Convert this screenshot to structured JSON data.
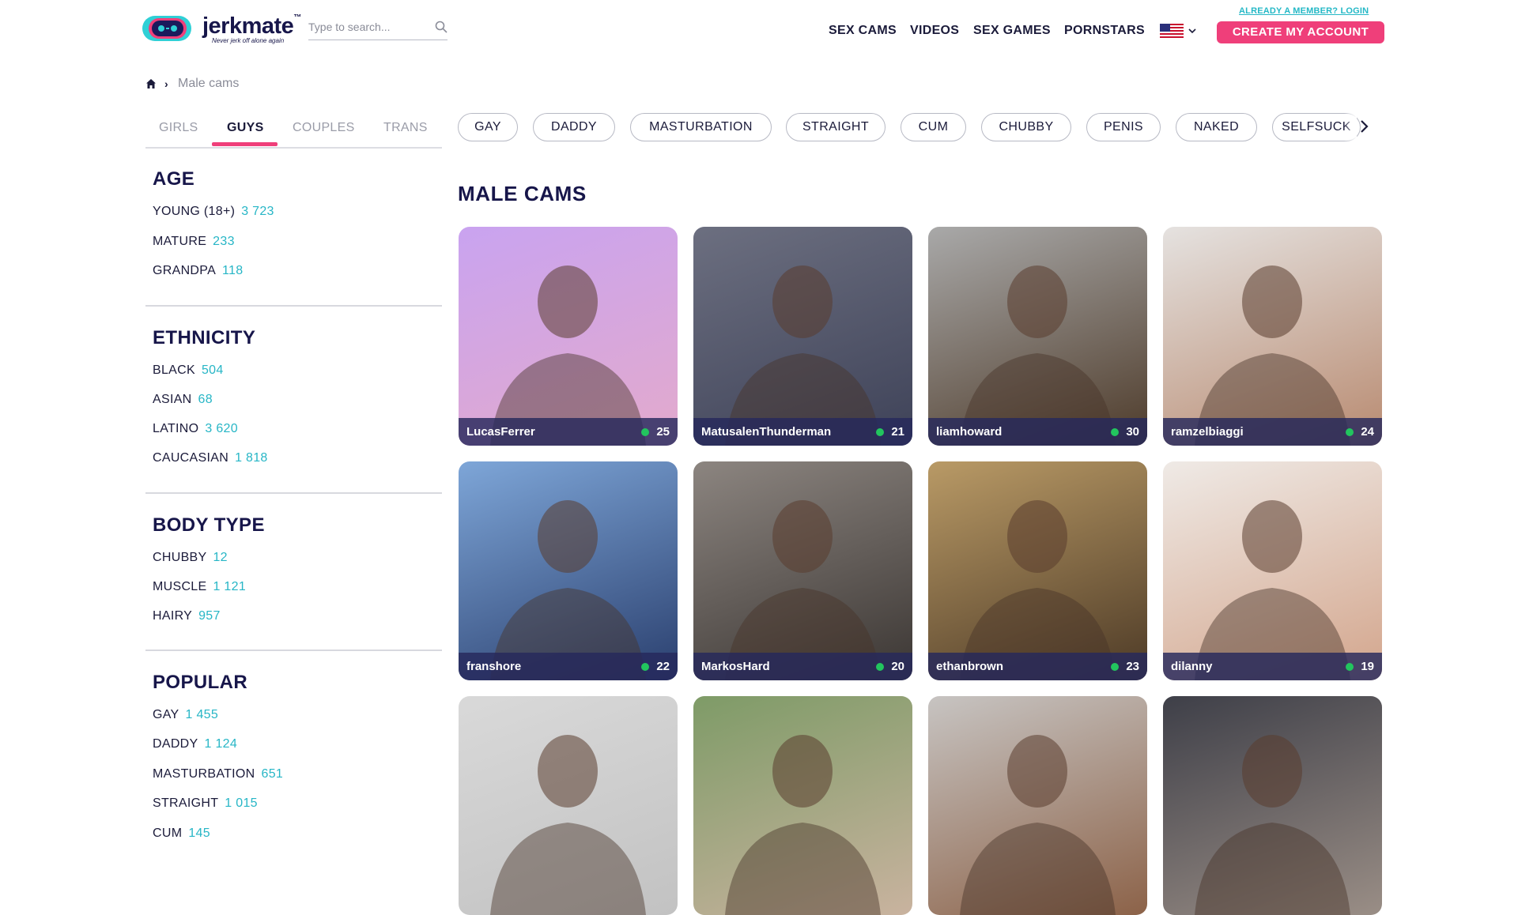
{
  "header": {
    "logo": {
      "word": "jerkmate",
      "tm": "™",
      "tagline": "Never jerk off alone again"
    },
    "search": {
      "placeholder": "Type to search..."
    },
    "nav": [
      "SEX CAMS",
      "VIDEOS",
      "SEX GAMES",
      "PORNSTARS"
    ],
    "language_icon": "us-flag-icon",
    "login_link": "ALREADY A MEMBER? LOGIN",
    "cta": "CREATE MY ACCOUNT"
  },
  "breadcrumb": {
    "current": "Male cams"
  },
  "category_tabs": {
    "items": [
      "GIRLS",
      "GUYS",
      "COUPLES",
      "TRANS"
    ],
    "active": "GUYS"
  },
  "sidebar": {
    "sections": [
      {
        "title": "AGE",
        "items": [
          {
            "label": "YOUNG (18+)",
            "count": "3 723"
          },
          {
            "label": "MATURE",
            "count": "233"
          },
          {
            "label": "GRANDPA",
            "count": "118"
          }
        ]
      },
      {
        "title": "ETHNICITY",
        "items": [
          {
            "label": "BLACK",
            "count": "504"
          },
          {
            "label": "ASIAN",
            "count": "68"
          },
          {
            "label": "LATINO",
            "count": "3 620"
          },
          {
            "label": "CAUCASIAN",
            "count": "1 818"
          }
        ]
      },
      {
        "title": "BODY TYPE",
        "items": [
          {
            "label": "CHUBBY",
            "count": "12"
          },
          {
            "label": "MUSCLE",
            "count": "1 121"
          },
          {
            "label": "HAIRY",
            "count": "957"
          }
        ]
      },
      {
        "title": "POPULAR",
        "items": [
          {
            "label": "GAY",
            "count": "1 455"
          },
          {
            "label": "DADDY",
            "count": "1 124"
          },
          {
            "label": "MASTURBATION",
            "count": "651"
          },
          {
            "label": "STRAIGHT",
            "count": "1 015"
          },
          {
            "label": "CUM",
            "count": "145"
          }
        ]
      }
    ]
  },
  "tags": [
    "GAY",
    "DADDY",
    "MASTURBATION",
    "STRAIGHT",
    "CUM",
    "CHUBBY",
    "PENIS",
    "NAKED",
    "SELFSUCK"
  ],
  "main": {
    "title": "MALE CAMS"
  },
  "cams": [
    {
      "name": "LucasFerrer",
      "age": "25",
      "colors": [
        "#c9a3f0",
        "#e3aacc"
      ]
    },
    {
      "name": "MatusalenThunderman",
      "age": "21",
      "colors": [
        "#6c6f80",
        "#3e4258"
      ]
    },
    {
      "name": "liamhoward",
      "age": "30",
      "colors": [
        "#a9a9a9",
        "#4e3b2a"
      ]
    },
    {
      "name": "ramzelbiaggi",
      "age": "24",
      "colors": [
        "#e5e2e0",
        "#b88a70"
      ]
    },
    {
      "name": "franshore",
      "age": "22",
      "colors": [
        "#7ea6d8",
        "#2a3f6e"
      ]
    },
    {
      "name": "MarkosHard",
      "age": "20",
      "colors": [
        "#8c8580",
        "#3b3633"
      ]
    },
    {
      "name": "ethanbrown",
      "age": "23",
      "colors": [
        "#b99a66",
        "#4d3a26"
      ]
    },
    {
      "name": "dilanny",
      "age": "19",
      "colors": [
        "#efeae6",
        "#d3a58c"
      ]
    },
    {
      "name": "",
      "age": "",
      "colors": [
        "#d9d9d9",
        "#c2c2c2"
      ]
    },
    {
      "name": "",
      "age": "",
      "colors": [
        "#7e9b67",
        "#c9b39f"
      ]
    },
    {
      "name": "",
      "age": "",
      "colors": [
        "#c7c4c2",
        "#8c6248"
      ]
    },
    {
      "name": "",
      "age": "",
      "colors": [
        "#3e3f48",
        "#9a8e86"
      ]
    }
  ]
}
